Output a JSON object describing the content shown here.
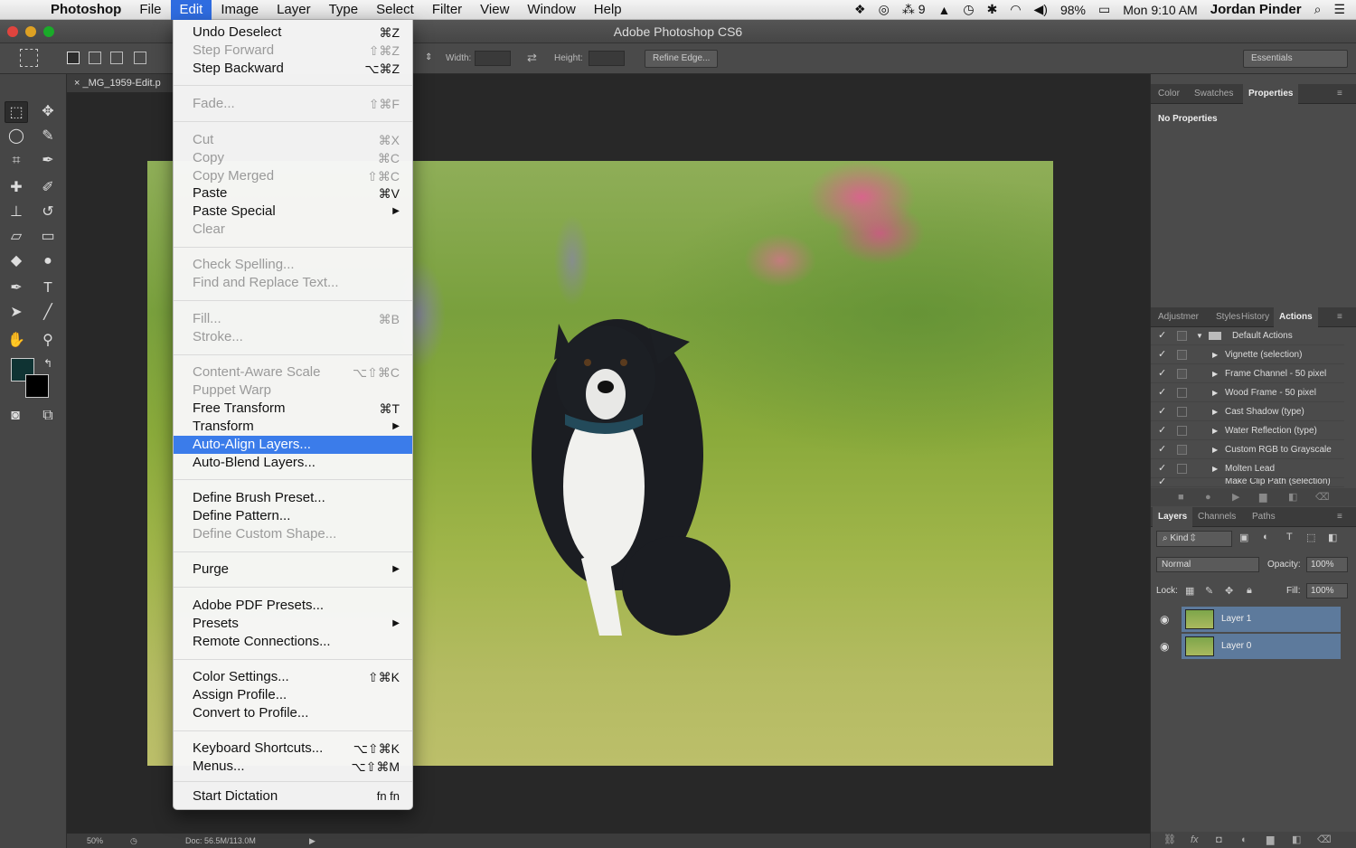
{
  "menubar": {
    "app_name": "Photoshop",
    "items": [
      "File",
      "Edit",
      "Image",
      "Layer",
      "Type",
      "Select",
      "Filter",
      "View",
      "Window",
      "Help"
    ],
    "status": {
      "notif_count": "9",
      "battery": "98%",
      "clock": "Mon 9:10 AM",
      "user": "Jordan Pinder"
    }
  },
  "window": {
    "title": "Adobe Photoshop CS6"
  },
  "options": {
    "width_label": "Width:",
    "height_label": "Height:",
    "refine_edge": "Refine Edge...",
    "workspace": "Essentials"
  },
  "document": {
    "tab_name": "_MG_1959-Edit.p",
    "zoom": "50%",
    "doc_size": "Doc: 56.5M/113.0M"
  },
  "properties_panel": {
    "tabs": [
      "Color",
      "Swatches",
      "Properties"
    ],
    "active_tab": "Properties",
    "content": "No Properties"
  },
  "actions_panel": {
    "tabs": [
      "Adjustmer",
      "Styles",
      "History",
      "Actions"
    ],
    "set_name": "Default Actions",
    "actions": [
      "Vignette (selection)",
      "Frame Channel - 50 pixel",
      "Wood Frame - 50 pixel",
      "Cast Shadow (type)",
      "Water Reflection (type)",
      "Custom RGB to Grayscale",
      "Molten Lead",
      "Make Clip Path (selection)"
    ]
  },
  "layers_panel": {
    "tabs": [
      "Layers",
      "Channels",
      "Paths"
    ],
    "kind": "Kind",
    "blend_mode": "Normal",
    "opacity_label": "Opacity:",
    "opacity": "100%",
    "lock_label": "Lock:",
    "fill_label": "Fill:",
    "fill": "100%",
    "layers": [
      "Layer 1",
      "Layer 0"
    ]
  },
  "edit_menu": {
    "items": [
      {
        "label": "Undo Deselect",
        "shortcut": "⌘Z"
      },
      {
        "label": "Step Forward",
        "shortcut": "⇧⌘Z"
      },
      {
        "label": "Step Backward",
        "shortcut": "⌥⌘Z"
      },
      {
        "label": "Fade...",
        "shortcut": "⇧⌘F"
      },
      {
        "label": "Cut",
        "shortcut": "⌘X"
      },
      {
        "label": "Copy",
        "shortcut": "⌘C"
      },
      {
        "label": "Copy Merged",
        "shortcut": "⇧⌘C"
      },
      {
        "label": "Paste",
        "shortcut": "⌘V"
      },
      {
        "label": "Paste Special",
        "shortcut": ""
      },
      {
        "label": "Clear",
        "shortcut": ""
      },
      {
        "label": "Check Spelling...",
        "shortcut": ""
      },
      {
        "label": "Find and Replace Text...",
        "shortcut": ""
      },
      {
        "label": "Fill...",
        "shortcut": "⌘B"
      },
      {
        "label": "Stroke...",
        "shortcut": ""
      },
      {
        "label": "Content-Aware Scale",
        "shortcut": "⌥⇧⌘C"
      },
      {
        "label": "Puppet Warp",
        "shortcut": ""
      },
      {
        "label": "Free Transform",
        "shortcut": "⌘T"
      },
      {
        "label": "Transform",
        "shortcut": ""
      },
      {
        "label": "Auto-Align Layers...",
        "shortcut": ""
      },
      {
        "label": "Auto-Blend Layers...",
        "shortcut": ""
      },
      {
        "label": "Define Brush Preset...",
        "shortcut": ""
      },
      {
        "label": "Define Pattern...",
        "shortcut": ""
      },
      {
        "label": "Define Custom Shape...",
        "shortcut": ""
      },
      {
        "label": "Purge",
        "shortcut": ""
      },
      {
        "label": "Adobe PDF Presets...",
        "shortcut": ""
      },
      {
        "label": "Presets",
        "shortcut": ""
      },
      {
        "label": "Remote Connections...",
        "shortcut": ""
      },
      {
        "label": "Color Settings...",
        "shortcut": "⇧⌘K"
      },
      {
        "label": "Assign Profile...",
        "shortcut": ""
      },
      {
        "label": "Convert to Profile...",
        "shortcut": ""
      },
      {
        "label": "Keyboard Shortcuts...",
        "shortcut": "⌥⇧⌘K"
      },
      {
        "label": "Menus...",
        "shortcut": "⌥⇧⌘M"
      },
      {
        "label": "Start Dictation",
        "shortcut": "fn fn"
      }
    ]
  }
}
